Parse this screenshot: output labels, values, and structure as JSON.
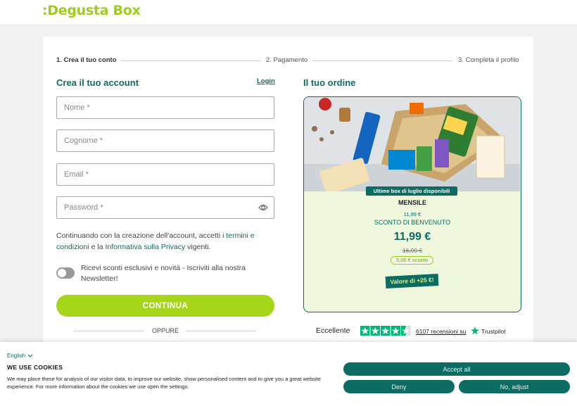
{
  "header": {
    "logo": ":Degusta Box"
  },
  "steps": [
    {
      "label": "1. Crea il tuo conto"
    },
    {
      "label": "2. Pagamento"
    },
    {
      "label": "3. Completa il profilo"
    }
  ],
  "account": {
    "title": "Crea il tuo account",
    "login_label": "Login",
    "fields": {
      "nome_placeholder": "Nome *",
      "cognome_placeholder": "Cognome *",
      "email_placeholder": "Email *",
      "password_placeholder": "Password *"
    },
    "terms": {
      "text_before": "Continuando con la creazione dell'account, accetti i ",
      "terms_link": "termini e condizioni",
      "text_middle": " e la ",
      "privacy_link": "Informativa sulla Privacy",
      "text_after": " vigenti."
    },
    "newsletter_label": "Ricevi sconti esclusivi e novità - Iscriviti alla nostra Newsletter!",
    "continue_label": "CONTINUA",
    "or_label": "OPPURE"
  },
  "order": {
    "title": "Il tuo ordine",
    "badge": "Ultime box di luglio disponibili",
    "plan": "MENSILE",
    "small_price": "11,99 €",
    "welcome_label": "SCONTO DI BENVENUTO",
    "price": "11,99 €",
    "old_price": "16,99 €",
    "discount": "5,00 € sconto",
    "value_tag": "Valore di +25 €!"
  },
  "trustpilot": {
    "label": "Eccellente",
    "rating_stars": 4.5,
    "reviews": "6107 recensioni su",
    "brand": "Trustpilot"
  },
  "cookie_banner": {
    "language": "English",
    "title": "WE USE COOKIES",
    "text": "We may place these for analysis of our visitor data, to improve our website, show personalised content and to give you a great website experience. For more information about the cookies we use open the settings.",
    "accept_all": "Accept all",
    "deny": "Deny",
    "adjust": "No, adjust"
  },
  "colors": {
    "brand_green": "#9ccd1e",
    "primary_teal": "#0c6b63",
    "button_lime": "#a6d61a",
    "trustpilot_green": "#00b67a"
  }
}
